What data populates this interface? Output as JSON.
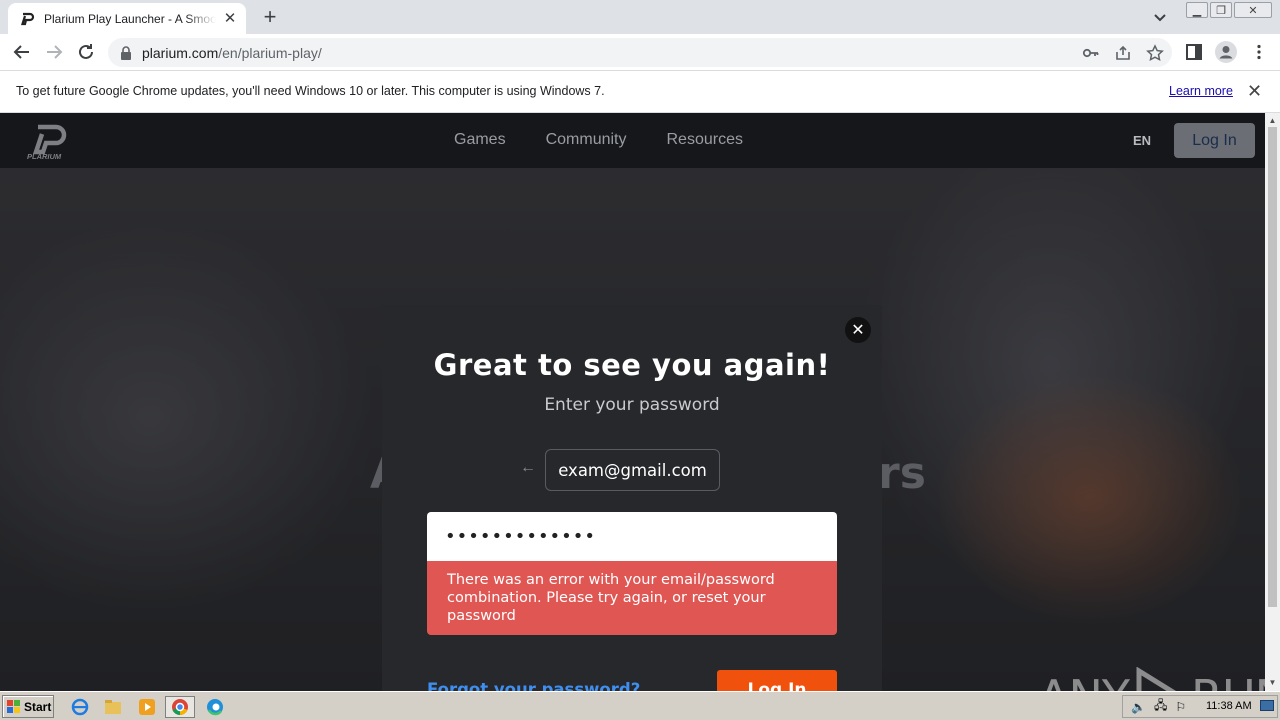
{
  "browser": {
    "tab_title": "Plarium Play Launcher - A Smoother Gaming Experience",
    "url_host": "plarium.com",
    "url_path": "/en/plarium-play/"
  },
  "infobar": {
    "message": "To get future Google Chrome updates, you'll need Windows 10 or later. This computer is using Windows 7.",
    "link": "Learn more"
  },
  "site": {
    "logo_text": "PLARIUM",
    "nav": [
      "Games",
      "Community",
      "Resources"
    ],
    "language": "EN",
    "header_login": "Log In",
    "hero_left": "A",
    "hero_right": "rs"
  },
  "modal": {
    "title": "Great to see you again!",
    "subtitle": "Enter your password",
    "email": "exam@gmail.com",
    "password_mask": "•••••••••••••",
    "error": "There was an error with your email/password combination. Please try again, or reset your password",
    "forgot": "Forgot your password?",
    "login": "Log In"
  },
  "watermark": {
    "left": "ANY",
    "right": "RUN"
  },
  "taskbar": {
    "start": "Start",
    "clock": "11:38 AM"
  },
  "colors": {
    "accent_orange": "#f0520e",
    "error_red": "#e05653",
    "link_blue": "#3f8ff0"
  }
}
